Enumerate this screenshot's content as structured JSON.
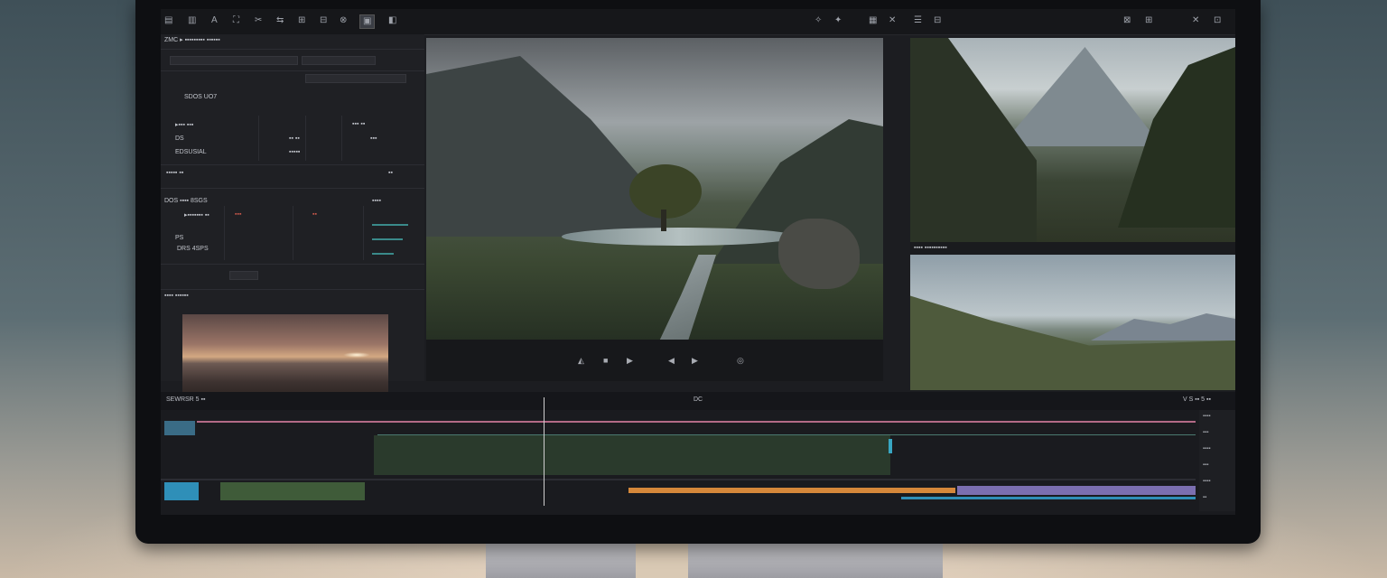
{
  "toolbar": {
    "left_icons": [
      "▤",
      "▥",
      "A",
      "⛶",
      "✂",
      "⇆",
      "⊞",
      "⊟",
      "⊗",
      "◧"
    ],
    "selected_label": "▣",
    "right_icons": [
      "✧",
      "✦",
      "▦",
      "✕",
      "☰",
      "⊟",
      "⊠",
      "⊞",
      "✕",
      "⊡"
    ]
  },
  "left_panel": {
    "header": "ZMC ▸ ▪▪▪▪▪▪▪▪▪ ▪▪▪▪▪▪",
    "rows": [
      "SDOS UO7",
      "▸▪▪▪ ▪▪▪",
      "DS",
      "EDSUSIAL",
      "▪▪▪▪▪ ▪▪",
      "DOS ▪▪▪▪ 8SGS",
      "▸▪▪▪▪▪▪▪ ▪▪",
      "PS",
      "DRS 4SPS"
    ],
    "values": [
      "▪▪▪ ▪▪",
      "▪▪ ▪▪",
      "▪▪▪",
      "▪▪▪▪▪",
      "▪▪",
      "▪▪▪▪",
      "▪▪▪",
      "▪▪"
    ],
    "thumb_label": "▪▪▪▪ ▪▪▪▪▪▪"
  },
  "transport": {
    "buttons": [
      "◭",
      "■",
      "▶",
      "◀",
      "▶",
      "◎"
    ]
  },
  "tr_label": "▪▪▪▪ ▪▪▪▪▪▪▪▪▪▪",
  "timeline": {
    "ruler_left": "SEWRSR 5 ▪▪",
    "ruler_right": "V S ▪▪ 5 ▪▪",
    "playhead_label": "DC"
  },
  "colors": {
    "accent_teal": "#3a8a8a",
    "clip_orange": "#d6883a",
    "clip_purple": "#7b6fb0",
    "clip_green": "#3f5b39",
    "clip_blue": "#2f8fb8"
  }
}
